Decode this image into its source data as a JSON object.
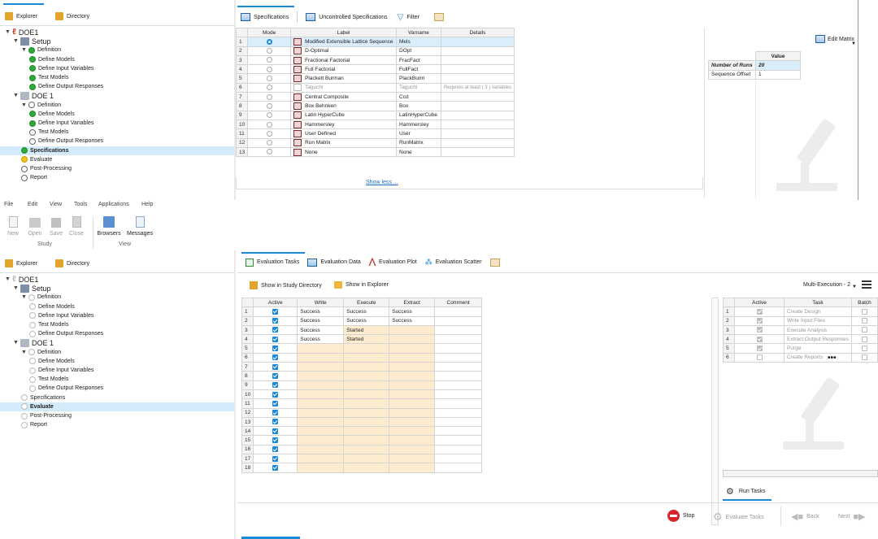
{
  "top": {
    "explorer_tab": "Explorer",
    "directory_tab": "Directory",
    "tabs": [
      "Specifications",
      "Uncontrolled Specifications",
      "Filter"
    ],
    "tree": [
      {
        "label": "DOE1",
        "level": 0,
        "icon": "doe-logo",
        "tri": "▼"
      },
      {
        "label": "Setup",
        "level": 1,
        "icon": "setup",
        "tri": "▼"
      },
      {
        "label": "Definition",
        "level": 2,
        "icon": "ok",
        "tri": "▼"
      },
      {
        "label": "Define Models",
        "level": 3,
        "icon": "ok"
      },
      {
        "label": "Define Input Variables",
        "level": 3,
        "icon": "ok"
      },
      {
        "label": "Test Models",
        "level": 3,
        "icon": "ok"
      },
      {
        "label": "Define Output Responses",
        "level": 3,
        "icon": "ok"
      },
      {
        "label": "DOE 1",
        "level": 1,
        "icon": "doe",
        "tri": "▼"
      },
      {
        "label": "Definition",
        "level": 2,
        "icon": "gray",
        "tri": "▼"
      },
      {
        "label": "Define Models",
        "level": 3,
        "icon": "ok"
      },
      {
        "label": "Define Input Variables",
        "level": 3,
        "icon": "ok"
      },
      {
        "label": "Test Models",
        "level": 3,
        "icon": "gray"
      },
      {
        "label": "Define Output Responses",
        "level": 3,
        "icon": "gray"
      },
      {
        "label": "Specifications",
        "level": 2,
        "icon": "ok",
        "selected": true
      },
      {
        "label": "Evaluate",
        "level": 2,
        "icon": "warn"
      },
      {
        "label": "Post-Processing",
        "level": 2,
        "icon": "gray"
      },
      {
        "label": "Report",
        "level": 2,
        "icon": "gray"
      }
    ],
    "spec_headers": [
      "Mode",
      "Label",
      "Varname",
      "Details"
    ],
    "spec_rows": [
      {
        "n": "1",
        "label": "Modified Extensible Lattice Sequence",
        "var": "Mels",
        "details": "",
        "on": true
      },
      {
        "n": "2",
        "label": "D-Optimal",
        "var": "DOpt",
        "details": ""
      },
      {
        "n": "3",
        "label": "Fractional Factorial",
        "var": "FracFact",
        "details": ""
      },
      {
        "n": "4",
        "label": "Full Factorial",
        "var": "FullFact",
        "details": ""
      },
      {
        "n": "5",
        "label": "Plackett Burman",
        "var": "PlackBurm",
        "details": ""
      },
      {
        "n": "6",
        "label": "Taguchi",
        "var": "Taguchi",
        "details": "Requires at least ( 3 ) variables",
        "muted": true
      },
      {
        "n": "7",
        "label": "Central Composite",
        "var": "Ccd",
        "details": ""
      },
      {
        "n": "8",
        "label": "Box Behnken",
        "var": "Box",
        "details": ""
      },
      {
        "n": "9",
        "label": "Latin HyperCube",
        "var": "LatinHyperCube",
        "details": ""
      },
      {
        "n": "10",
        "label": "Hammersley",
        "var": "Hammersley",
        "details": ""
      },
      {
        "n": "11",
        "label": "User Defined",
        "var": "User",
        "details": ""
      },
      {
        "n": "12",
        "label": "Run Matrix",
        "var": "RunMatrix",
        "details": ""
      },
      {
        "n": "13",
        "label": "None",
        "var": "None",
        "details": ""
      }
    ],
    "show_less": "Show less ...",
    "edit_matrix": "Edit Matrix",
    "value_header": "Value",
    "runs_label": "Number of Runs",
    "runs_value": "20",
    "offset_label": "Sequence Offset",
    "offset_value": "1"
  },
  "menu": [
    "File",
    "Edit",
    "View",
    "Tools",
    "Applications",
    "Help"
  ],
  "toolbar": {
    "study_buttons": [
      "New",
      "Open",
      "Save",
      "Close"
    ],
    "study_group": "Study",
    "view_buttons": [
      "Browsers",
      "Messages"
    ],
    "view_group": "View"
  },
  "bottom": {
    "explorer_tab": "Explorer",
    "directory_tab": "Directory",
    "tabs": [
      "Evaluation Tasks",
      "Evaluation Data",
      "Evaluation Plot",
      "Evaluation Scatter"
    ],
    "tree": [
      {
        "label": "DOE1",
        "level": 0,
        "icon": "doe-logo-dim",
        "tri": "▼"
      },
      {
        "label": "Setup",
        "level": 1,
        "icon": "setup",
        "tri": "▼"
      },
      {
        "label": "Definition",
        "level": 2,
        "icon": "dim",
        "tri": "▼"
      },
      {
        "label": "Define Models",
        "level": 3,
        "icon": "dim"
      },
      {
        "label": "Define Input Variables",
        "level": 3,
        "icon": "dim"
      },
      {
        "label": "Test Models",
        "level": 3,
        "icon": "dim"
      },
      {
        "label": "Define Output Responses",
        "level": 3,
        "icon": "dim"
      },
      {
        "label": "DOE 1",
        "level": 1,
        "icon": "doe",
        "tri": "▼"
      },
      {
        "label": "Definition",
        "level": 2,
        "icon": "dim",
        "tri": "▼"
      },
      {
        "label": "Define Models",
        "level": 3,
        "icon": "dim"
      },
      {
        "label": "Define Input Variables",
        "level": 3,
        "icon": "dim"
      },
      {
        "label": "Test Models",
        "level": 3,
        "icon": "dim"
      },
      {
        "label": "Define Output Responses",
        "level": 3,
        "icon": "dim"
      },
      {
        "label": "Specifications",
        "level": 2,
        "icon": "dim"
      },
      {
        "label": "Evaluate",
        "level": 2,
        "icon": "dim",
        "selected": true
      },
      {
        "label": "Post-Processing",
        "level": 2,
        "icon": "dim"
      },
      {
        "label": "Report",
        "level": 2,
        "icon": "dim"
      }
    ],
    "show_dir": "Show in Study Directory",
    "show_explorer": "Show in Explorer",
    "multi_exec": "Multi-Execution - 2",
    "eval_headers": [
      "Active",
      "Write",
      "Execute",
      "Extract",
      "Comment"
    ],
    "eval_rows": [
      {
        "n": "1",
        "write": "Success",
        "execute": "Success",
        "extract": "Success"
      },
      {
        "n": "2",
        "write": "Success",
        "execute": "Success",
        "extract": "Success"
      },
      {
        "n": "3",
        "write": "Success",
        "execute": "Started",
        "extract": ""
      },
      {
        "n": "4",
        "write": "Success",
        "execute": "Started",
        "extract": ""
      },
      {
        "n": "5",
        "write": "",
        "execute": "",
        "extract": ""
      },
      {
        "n": "6",
        "write": "",
        "execute": "",
        "extract": ""
      },
      {
        "n": "7",
        "write": "",
        "execute": "",
        "extract": ""
      },
      {
        "n": "8",
        "write": "",
        "execute": "",
        "extract": ""
      },
      {
        "n": "9",
        "write": "",
        "execute": "",
        "extract": ""
      },
      {
        "n": "10",
        "write": "",
        "execute": "",
        "extract": ""
      },
      {
        "n": "11",
        "write": "",
        "execute": "",
        "extract": ""
      },
      {
        "n": "12",
        "write": "",
        "execute": "",
        "extract": ""
      },
      {
        "n": "13",
        "write": "",
        "execute": "",
        "extract": ""
      },
      {
        "n": "14",
        "write": "",
        "execute": "",
        "extract": ""
      },
      {
        "n": "15",
        "write": "",
        "execute": "",
        "extract": ""
      },
      {
        "n": "16",
        "write": "",
        "execute": "",
        "extract": ""
      },
      {
        "n": "17",
        "write": "",
        "execute": "",
        "extract": ""
      },
      {
        "n": "18",
        "write": "",
        "execute": "",
        "extract": ""
      }
    ],
    "task_headers": [
      "Active",
      "Task",
      "Batch"
    ],
    "task_rows": [
      {
        "n": "1",
        "task": "Create Design",
        "active": true
      },
      {
        "n": "2",
        "task": "Write Input Files",
        "active": true
      },
      {
        "n": "3",
        "task": "Execute Analysis",
        "active": true
      },
      {
        "n": "4",
        "task": "Extract Output Responses",
        "active": true
      },
      {
        "n": "5",
        "task": "Purge",
        "active": true
      },
      {
        "n": "6",
        "task": "Create Reports",
        "active": false
      }
    ],
    "run_tasks": "Run Tasks",
    "stop": "Stop",
    "evaluate_tasks": "Evaluate Tasks",
    "back": "Back",
    "next": "Next"
  }
}
